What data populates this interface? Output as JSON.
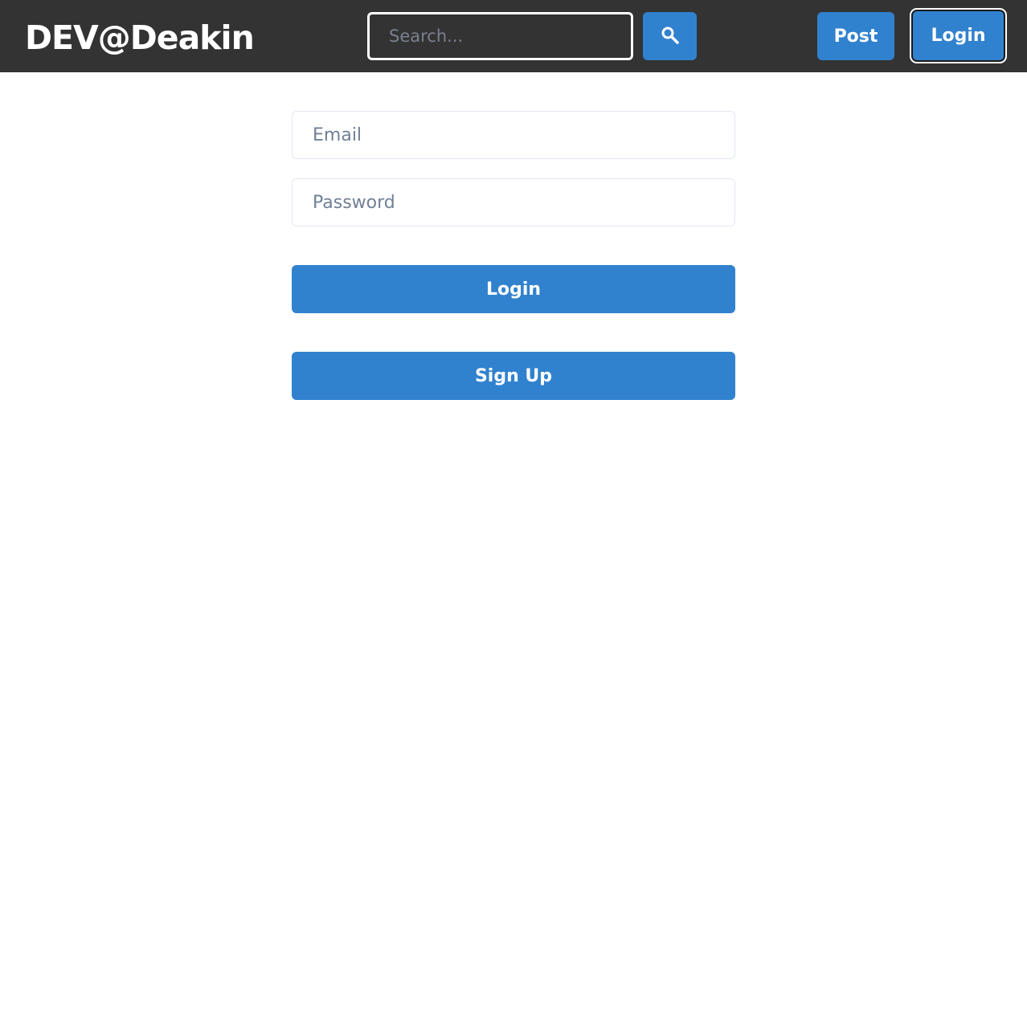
{
  "header": {
    "brand": "DEV@Deakin",
    "search_placeholder": "Search...",
    "search_icon": "search-icon",
    "post_label": "Post",
    "login_label": "Login"
  },
  "form": {
    "email_placeholder": "Email",
    "password_placeholder": "Password",
    "login_label": "Login",
    "signup_label": "Sign Up"
  },
  "colors": {
    "header_bg": "#333333",
    "accent": "#3182ce",
    "text_on_accent": "#ffffff",
    "placeholder": "#718096"
  }
}
